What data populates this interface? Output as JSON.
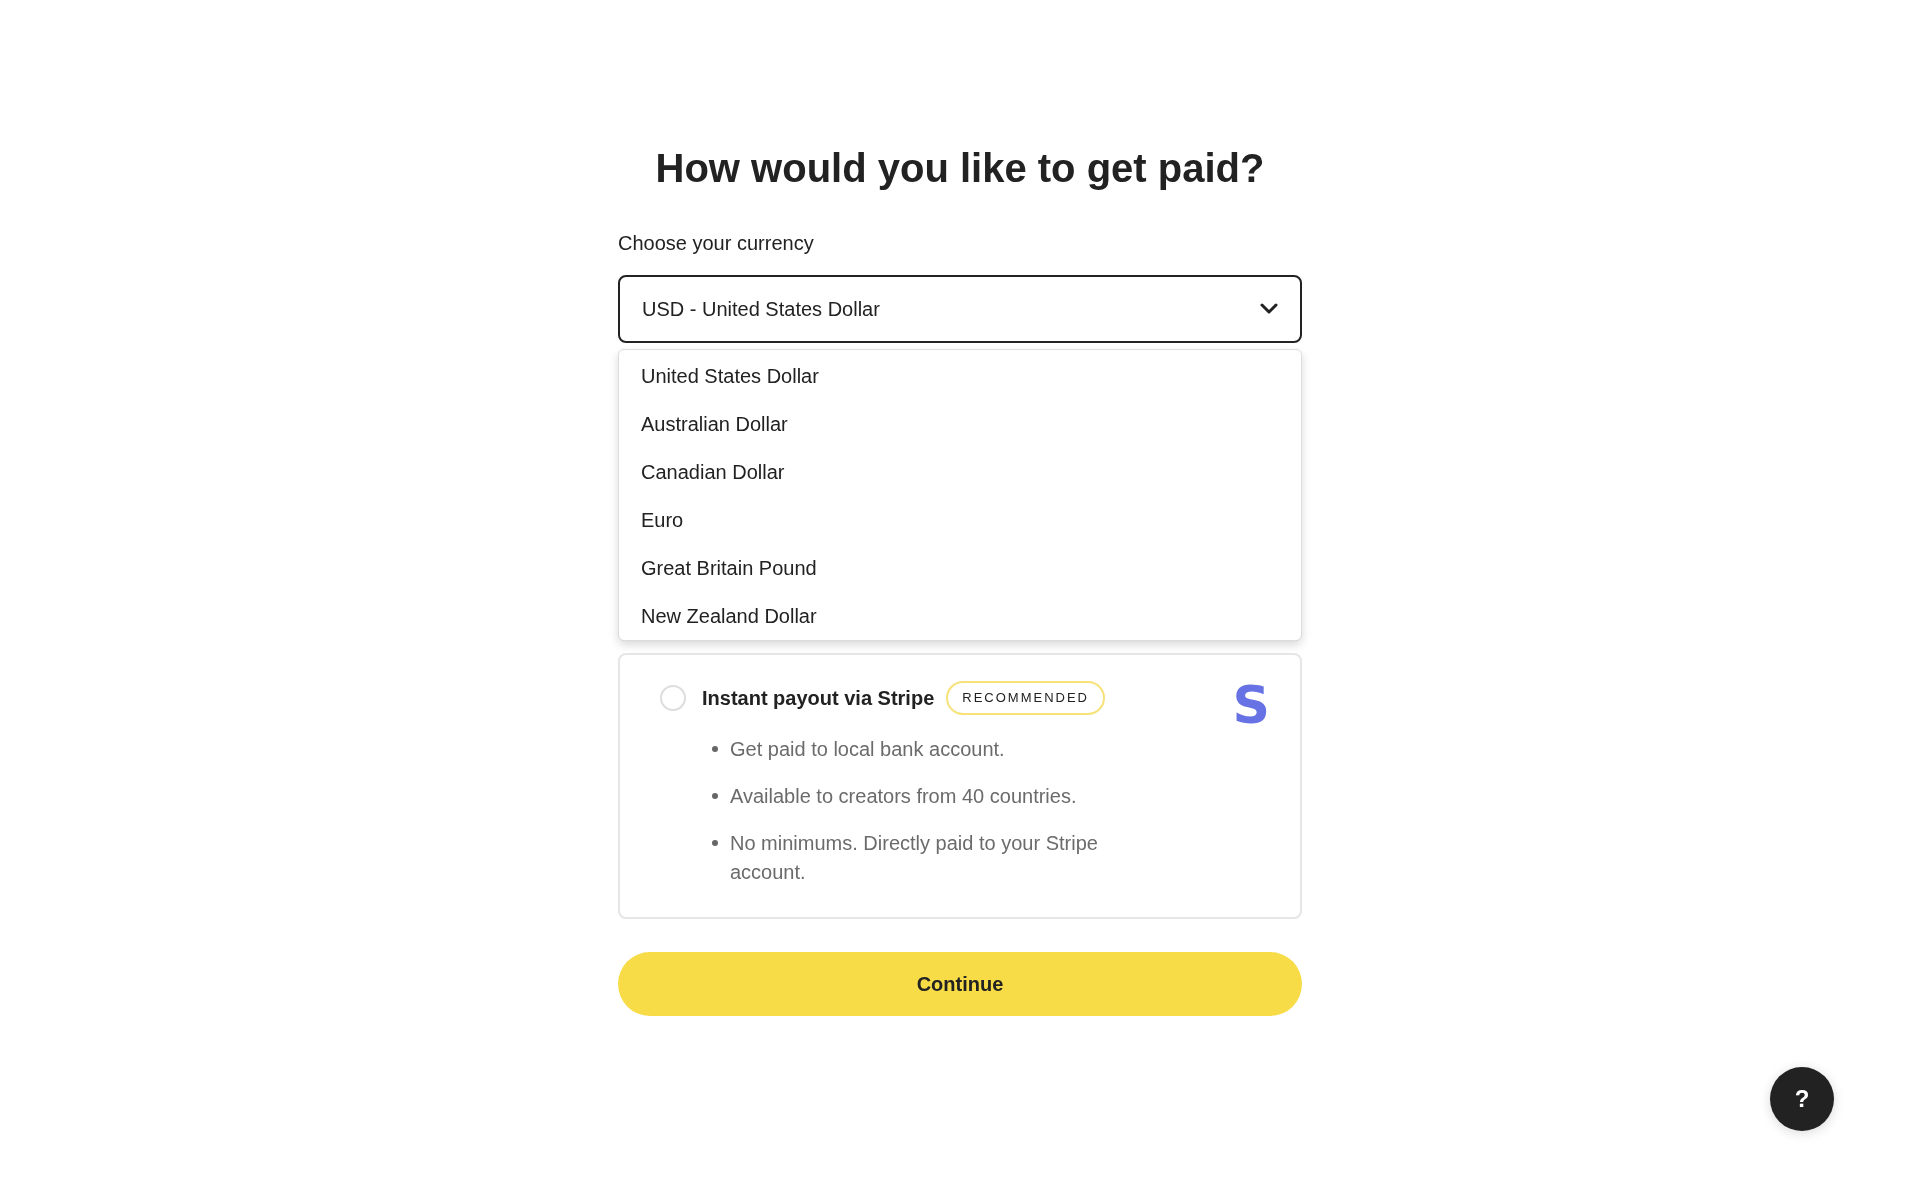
{
  "heading": "How would you like to get paid?",
  "currency": {
    "label": "Choose your currency",
    "value": "USD - United States Dollar",
    "expanded": true,
    "options": [
      "United States Dollar",
      "Australian Dollar",
      "Canadian Dollar",
      "Euro",
      "Great Britain Pound",
      "New Zealand Dollar"
    ]
  },
  "payout_options": [
    {
      "title": "Instant payout via Stripe",
      "selected": false,
      "badge": "RECOMMENDED",
      "logo": "S",
      "bullets": [
        "Get paid to local bank account.",
        "Available to creators from 40 countries.",
        "No minimums. Directly paid to your Stripe account."
      ]
    }
  ],
  "continue_button": "Continue",
  "help_button": "?"
}
